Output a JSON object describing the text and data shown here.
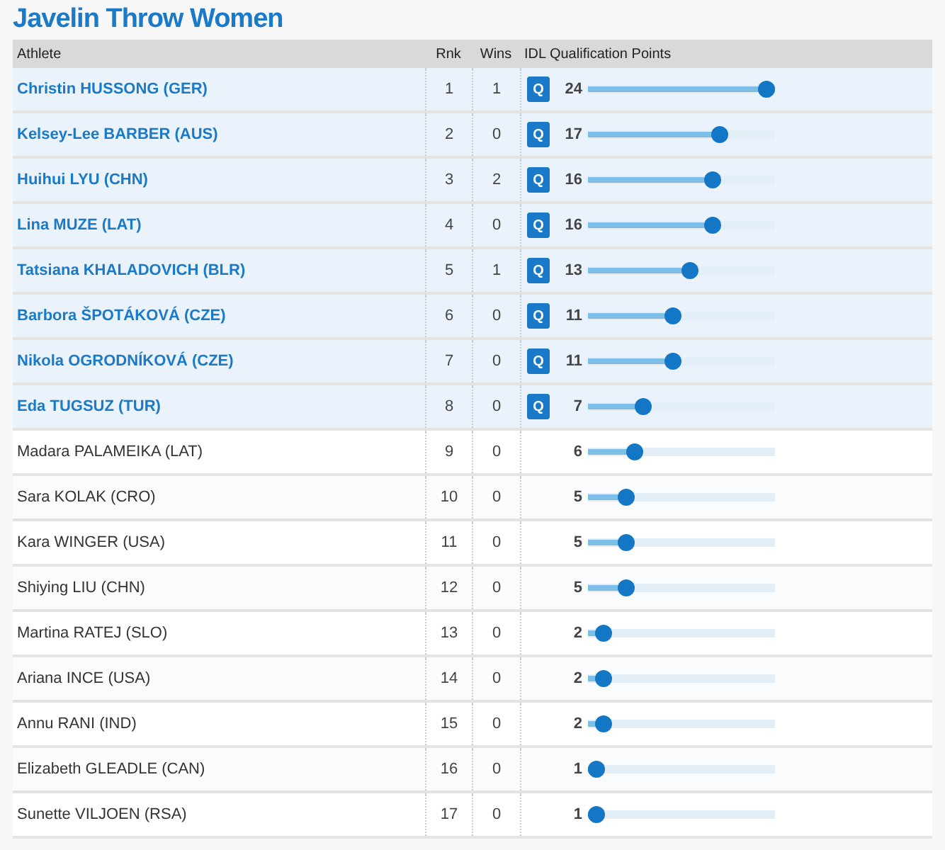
{
  "title": "Javelin Throw Women",
  "columns": [
    "Athlete",
    "Rnk",
    "Wins",
    "IDL Qualification Points"
  ],
  "rows": [
    {
      "athlete": "Christin HUSSONG (GER)",
      "rank": "1",
      "wins": "1",
      "qualified": true,
      "badge": "Q",
      "points": "24",
      "level": 1
    },
    {
      "athlete": "Kelsey-Lee BARBER (AUS)",
      "rank": "2",
      "wins": "0",
      "qualified": true,
      "badge": "Q",
      "points": "17",
      "level": 0.708
    },
    {
      "athlete": "Huihui LYU (CHN)",
      "rank": "3",
      "wins": "2",
      "qualified": true,
      "badge": "Q",
      "points": "16",
      "level": 0.667
    },
    {
      "athlete": "Lina MUZE (LAT)",
      "rank": "4",
      "wins": "0",
      "qualified": true,
      "badge": "Q",
      "points": "16",
      "level": 0.667
    },
    {
      "athlete": "Tatsiana KHALADOVICH (BLR)",
      "rank": "5",
      "wins": "1",
      "qualified": true,
      "badge": "Q",
      "points": "13",
      "level": 0.542
    },
    {
      "athlete": "Barbora ŠPOTÁKOVÁ (CZE)",
      "rank": "6",
      "wins": "0",
      "qualified": true,
      "badge": "Q",
      "points": "11",
      "level": 0.458
    },
    {
      "athlete": "Nikola OGRODNÍKOVÁ (CZE)",
      "rank": "7",
      "wins": "0",
      "qualified": true,
      "badge": "Q",
      "points": "11",
      "level": 0.458
    },
    {
      "athlete": "Eda TUGSUZ (TUR)",
      "rank": "8",
      "wins": "0",
      "qualified": true,
      "badge": "Q",
      "points": "7",
      "level": 0.292
    },
    {
      "athlete": "Madara PALAMEIKA (LAT)",
      "rank": "9",
      "wins": "0",
      "qualified": false,
      "points": "6",
      "level": 0.25
    },
    {
      "athlete": "Sara KOLAK (CRO)",
      "rank": "10",
      "wins": "0",
      "qualified": false,
      "points": "5",
      "level": 0.208
    },
    {
      "athlete": "Kara WINGER (USA)",
      "rank": "11",
      "wins": "0",
      "qualified": false,
      "points": "5",
      "level": 0.208
    },
    {
      "athlete": "Shiying LIU (CHN)",
      "rank": "12",
      "wins": "0",
      "qualified": false,
      "points": "5",
      "level": 0.208
    },
    {
      "athlete": "Martina RATEJ (SLO)",
      "rank": "13",
      "wins": "0",
      "qualified": false,
      "points": "2",
      "level": 0.083
    },
    {
      "athlete": "Ariana INCE (USA)",
      "rank": "14",
      "wins": "0",
      "qualified": false,
      "points": "2",
      "level": 0.083
    },
    {
      "athlete": "Annu RANI (IND)",
      "rank": "15",
      "wins": "0",
      "qualified": false,
      "points": "2",
      "level": 0.083
    },
    {
      "athlete": "Elizabeth GLEADLE (CAN)",
      "rank": "16",
      "wins": "0",
      "qualified": false,
      "points": "1",
      "level": 0.042
    },
    {
      "athlete": "Sunette VILJOEN (RSA)",
      "rank": "17",
      "wins": "0",
      "qualified": false,
      "points": "1",
      "level": 0.042
    }
  ]
}
